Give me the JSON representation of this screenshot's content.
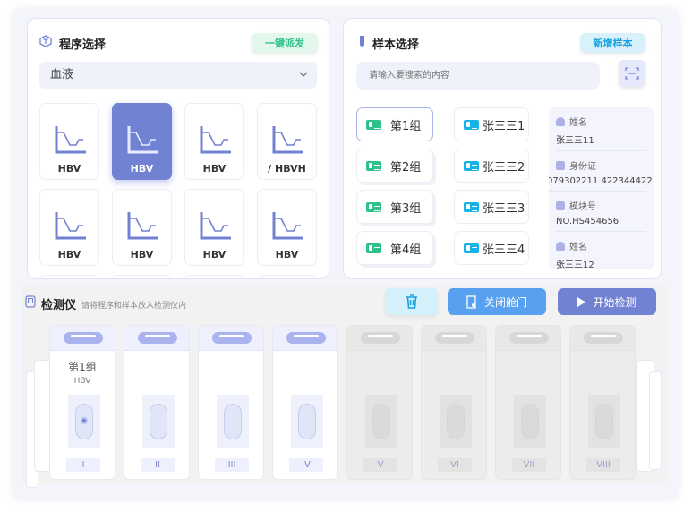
{
  "program": {
    "title": "程序选择",
    "dispatch_button": "一键派发",
    "category": "血液",
    "items": [
      "HBV",
      "HBV",
      "HBV",
      "/  HBVH",
      "HBV",
      "HBV",
      "HBV",
      "HBV"
    ],
    "selected_index": 1
  },
  "sample": {
    "title": "样本选择",
    "add_button": "新增样本",
    "search_placeholder": "请输入要搜索的内容",
    "groups": [
      "第1组",
      "第2组",
      "第3组",
      "第4组"
    ],
    "people": [
      "张三三1",
      "张三三2",
      "张三三3",
      "张三三4"
    ],
    "info": [
      {
        "label": "姓名",
        "value": "张三三11"
      },
      {
        "label": "身份证",
        "value": "079302211  422344422"
      },
      {
        "label": "模块号",
        "value": "NO.HS454656"
      },
      {
        "label": "姓名",
        "value": "张三三12"
      }
    ]
  },
  "detector": {
    "title": "检测仪",
    "hint": "请将程序和样本放入检测仪内",
    "delete_button_icon": "trash-icon",
    "close_door_button": "关闭舱门",
    "start_button": "开始检测",
    "slots": [
      {
        "numeral": "I",
        "group": "第1组",
        "program": "HBV",
        "active": true
      },
      {
        "numeral": "II",
        "active": true
      },
      {
        "numeral": "III",
        "active": true
      },
      {
        "numeral": "IV",
        "active": true
      },
      {
        "numeral": "V",
        "active": false
      },
      {
        "numeral": "VI",
        "active": false
      },
      {
        "numeral": "VII",
        "active": false
      },
      {
        "numeral": "VIII",
        "active": false
      }
    ]
  },
  "colors": {
    "accent": "#7282d2",
    "green": "#2ec28b",
    "cyan": "#16b3e8",
    "blue": "#58a0f0"
  }
}
